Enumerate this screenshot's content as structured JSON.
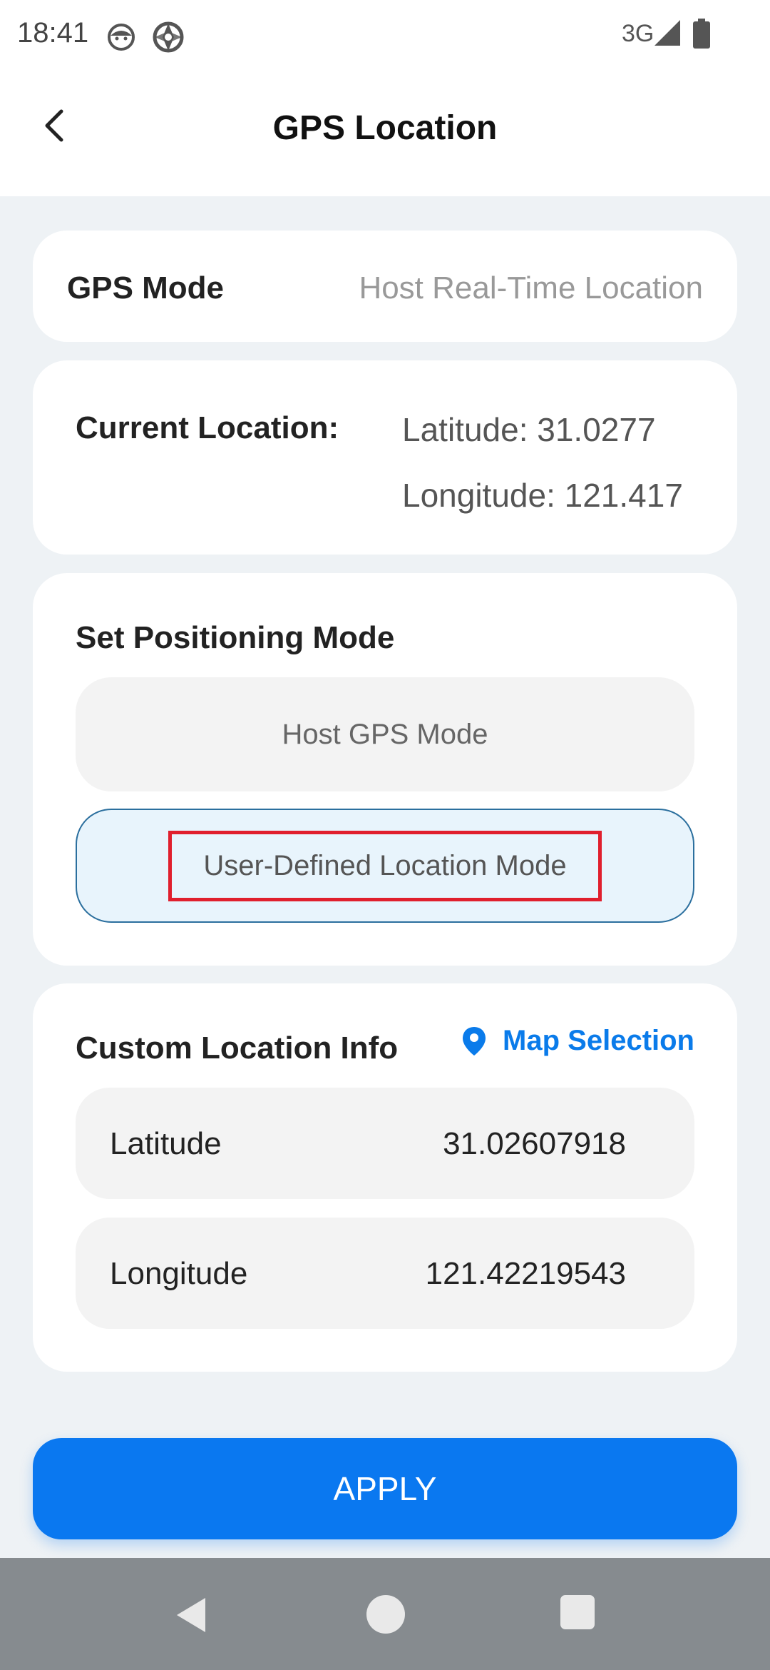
{
  "status_bar": {
    "time": "18:41",
    "network": "3G",
    "icons": [
      "face-icon",
      "aperture-icon",
      "signal-icon",
      "battery-icon"
    ]
  },
  "header": {
    "title": "GPS Location",
    "back_icon": "chevron-left-icon"
  },
  "gps_mode": {
    "label": "GPS Mode",
    "value": "Host Real-Time Location"
  },
  "current_location": {
    "label": "Current Location:",
    "latitude": "Latitude: 31.0277",
    "longitude": "Longitude: 121.417"
  },
  "positioning_mode": {
    "title": "Set Positioning Mode",
    "options": [
      {
        "label": "Host GPS Mode",
        "selected": false
      },
      {
        "label": "User-Defined Location Mode",
        "selected": true
      }
    ]
  },
  "custom_location": {
    "title": "Custom Location Info",
    "map_selection_label": "Map Selection",
    "map_icon": "map-pin-icon",
    "latitude_label": "Latitude",
    "latitude_value": "31.02607918",
    "longitude_label": "Longitude",
    "longitude_value": "121.42219543"
  },
  "apply_button": {
    "label": "APPLY"
  },
  "nav_bar": {
    "icons": [
      "nav-back-icon",
      "nav-home-icon",
      "nav-recent-icon"
    ]
  },
  "colors": {
    "accent": "#0a78f0",
    "link": "#0a7bea",
    "highlight_border": "#e01f2d",
    "selected_bg": "#e8f4fc",
    "background": "#eef2f5"
  }
}
